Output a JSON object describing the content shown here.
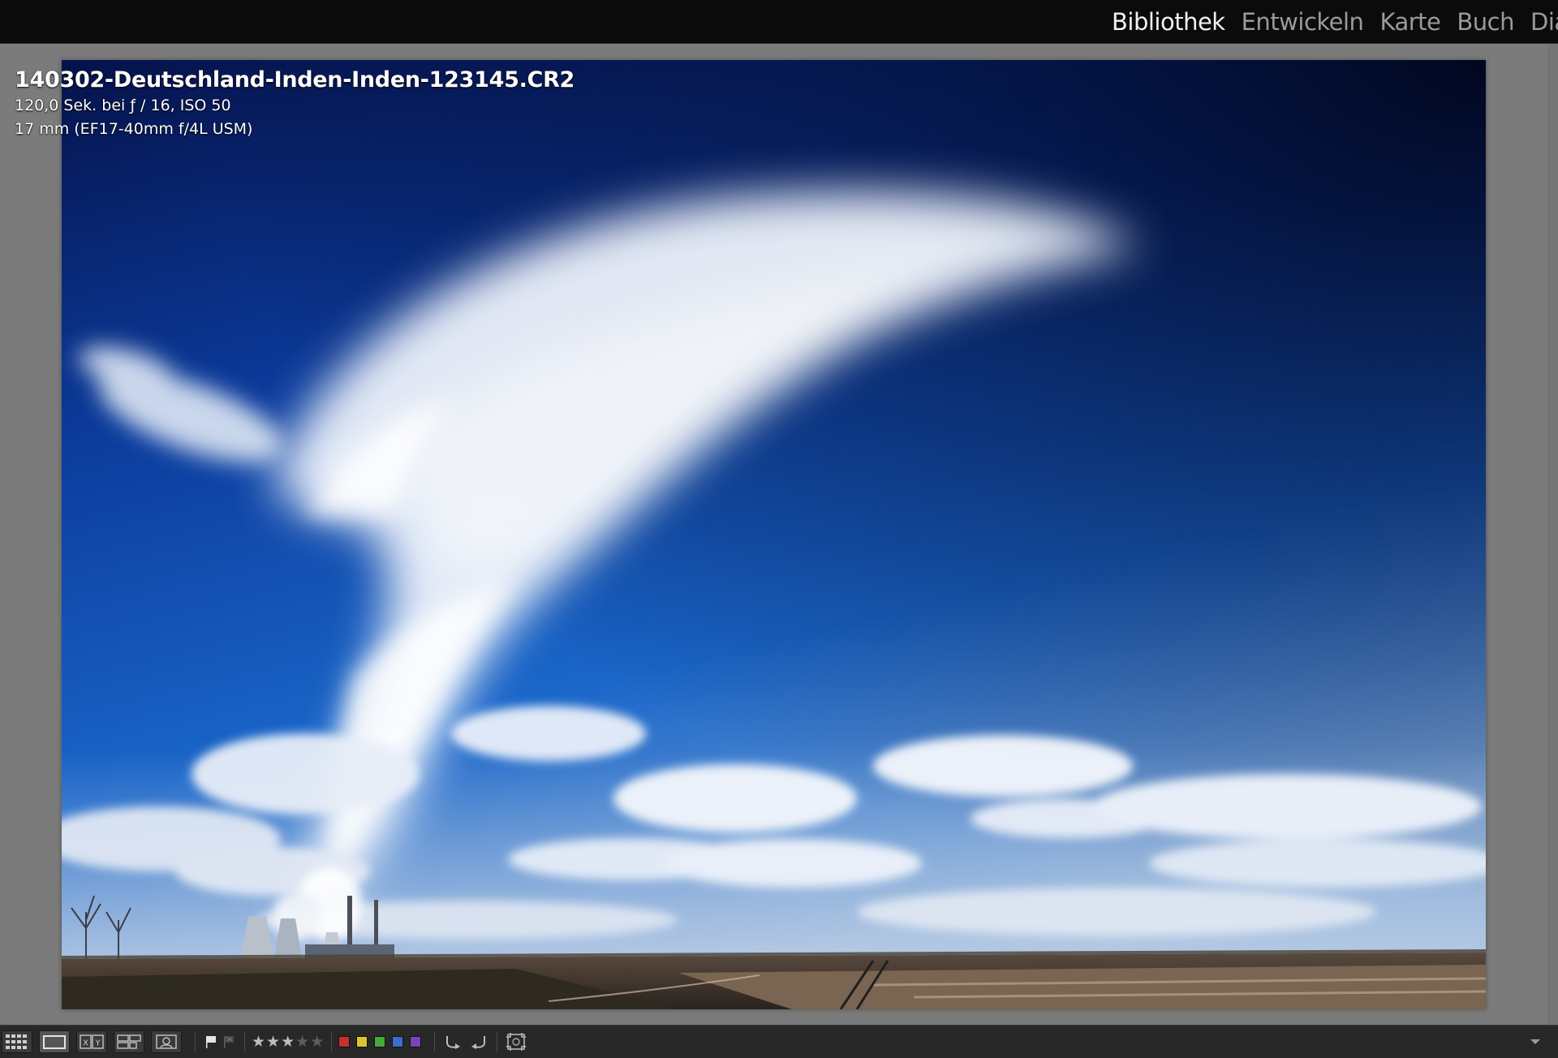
{
  "app": {
    "module_picker": [
      {
        "label": "Bibliothek",
        "active": true
      },
      {
        "label": "Entwickeln",
        "active": false
      },
      {
        "label": "Karte",
        "active": false
      },
      {
        "label": "Buch",
        "active": false
      },
      {
        "label": "Dias",
        "active": false
      }
    ]
  },
  "photo_info": {
    "filename": "140302-Deutschland-Inden-Inden-123145.CR2",
    "exposure": "120,0 Sek. bei ƒ / 16, ISO 50",
    "lens": "17 mm (EF17-40mm f/4L USM)"
  },
  "toolbar": {
    "views": [
      {
        "name": "grid-view",
        "icon": "grid-icon",
        "active": false
      },
      {
        "name": "loupe-view",
        "icon": "loupe-icon",
        "active": true
      },
      {
        "name": "compare-view",
        "icon": "xy-compare-icon",
        "label": "XY",
        "active": false
      },
      {
        "name": "survey-view",
        "icon": "survey-icon",
        "active": false
      },
      {
        "name": "people-view",
        "icon": "people-icon",
        "active": false
      }
    ],
    "flags": [
      "flag-pick-icon",
      "flag-reject-icon"
    ],
    "rating": {
      "value": 3,
      "max": 5
    },
    "color_labels": [
      {
        "name": "red",
        "color": "#c8302e"
      },
      {
        "name": "yellow",
        "color": "#d9c62c"
      },
      {
        "name": "green",
        "color": "#48a83c"
      },
      {
        "name": "blue",
        "color": "#3a6fd0"
      },
      {
        "name": "purple",
        "color": "#7a44b8"
      }
    ],
    "rotate": [
      "rotate-left-icon",
      "rotate-right-icon"
    ],
    "crop_icon": "crop-overlay-icon",
    "menu_icon": "chevron-down-icon"
  },
  "colors": {
    "background": "#7b7b7b",
    "top_bar": "#0b0b0b",
    "toolbar": "#282828",
    "active_module": "#f2f2f2",
    "inactive_module": "#9a9a9a"
  }
}
